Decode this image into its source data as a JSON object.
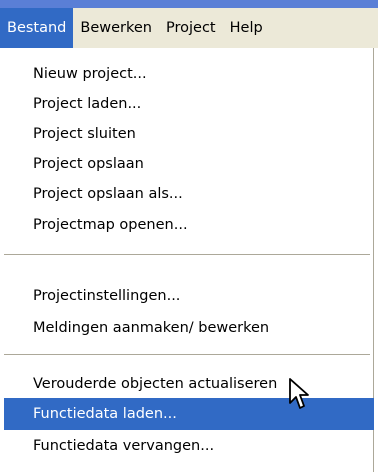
{
  "menubar": {
    "items": [
      "Bestand",
      "Bewerken",
      "Project",
      "Help"
    ],
    "active": "Bestand"
  },
  "menu": {
    "group1": [
      "Nieuw project...",
      "Project laden...",
      "Project sluiten",
      "Project opslaan",
      "Project opslaan als...",
      "Projectmap openen..."
    ],
    "group2": [
      "Projectinstellingen...",
      "Meldingen aanmaken/ bewerken"
    ],
    "group3": [
      "Verouderde objecten actualiseren",
      "Functiedata laden...",
      "Functiedata vervangen..."
    ],
    "highlighted": "Functiedata laden..."
  },
  "colors": {
    "highlight": "#316ac5",
    "menubar_bg": "#ece9d8",
    "title_strip": "#5a7fd6"
  },
  "icons": [
    "mouse-pointer-icon"
  ]
}
